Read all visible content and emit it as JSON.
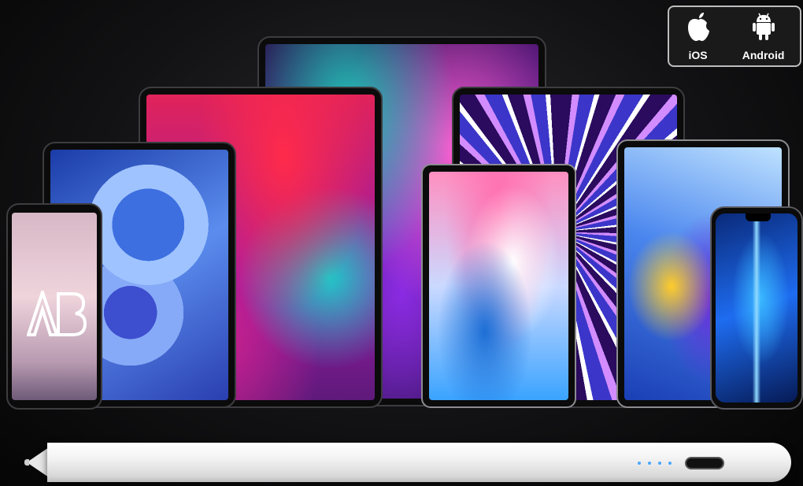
{
  "compatibility": {
    "ios_label": "iOS",
    "android_label": "Android"
  },
  "logo_text": "AB",
  "icons": [
    "apple-icon",
    "android-icon"
  ],
  "colors": {
    "background": "#121214",
    "badge_border": "#bdbdbd",
    "pencil": "#f3f3f3",
    "indicator_led": "#4aa8ff"
  }
}
